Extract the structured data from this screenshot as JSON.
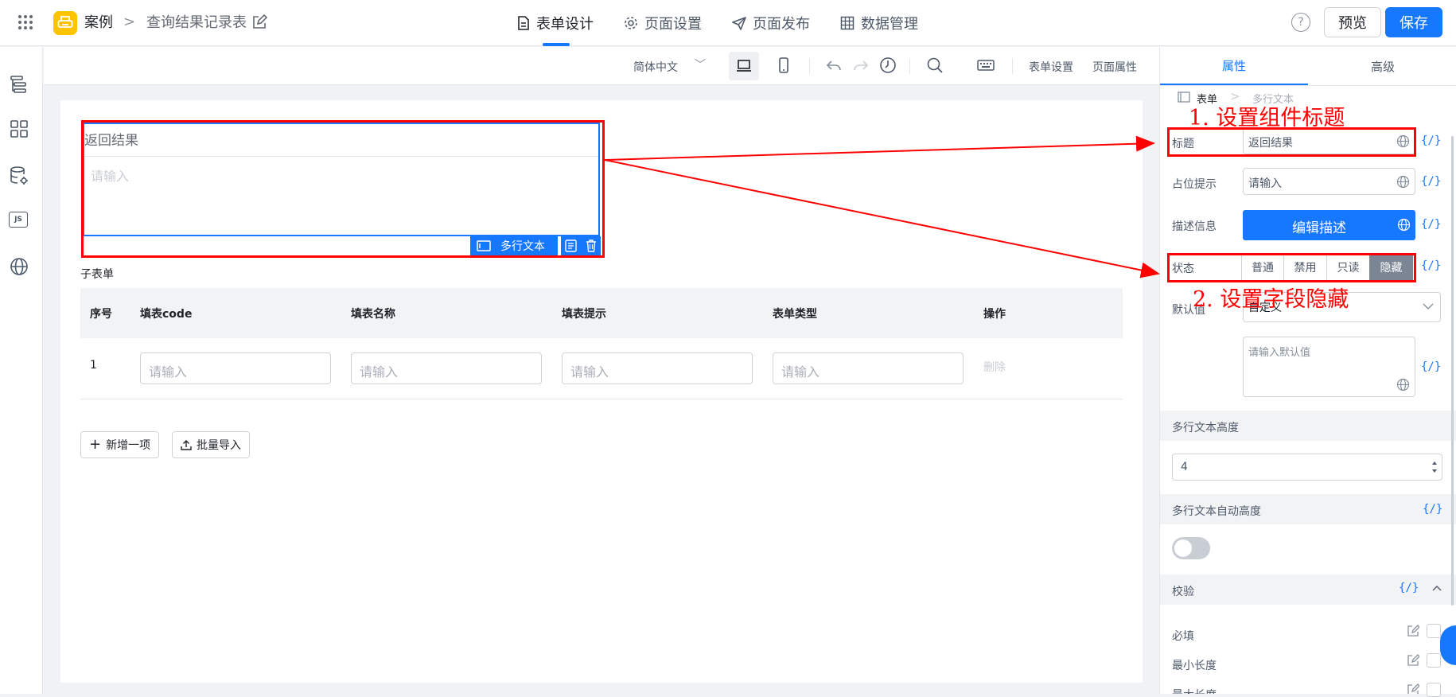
{
  "header": {
    "app_name": "案例",
    "breadcrumb_separator": ">",
    "page_name": "查询结果记录表",
    "tabs": [
      {
        "label": "表单设计",
        "icon": "document-icon",
        "active": true
      },
      {
        "label": "页面设置",
        "icon": "gear-icon",
        "active": false
      },
      {
        "label": "页面发布",
        "icon": "send-icon",
        "active": false
      },
      {
        "label": "数据管理",
        "icon": "table-icon",
        "active": false
      }
    ],
    "help_symbol": "?",
    "preview_label": "预览",
    "save_label": "保存",
    "accent_color": "#1677ff"
  },
  "left_sidebar": {
    "icons": [
      "outline-tree-icon",
      "components-grid-icon",
      "data-source-icon",
      "js-icon",
      "globe-icon"
    ],
    "js_text": "JS"
  },
  "toolbar": {
    "language": "简体中文",
    "language_chevron": "﹀",
    "form_settings": "表单设置",
    "page_properties": "页面属性"
  },
  "canvas": {
    "field": {
      "title": "返回结果",
      "placeholder": "请输入",
      "component_type": "多行文本"
    },
    "subform": {
      "title": "子表单",
      "columns": [
        "序号",
        "填表code",
        "填表名称",
        "填表提示",
        "表单类型",
        "操作"
      ],
      "row": {
        "index": "1",
        "placeholders": [
          "请输入",
          "请输入",
          "请输入",
          "请输入"
        ],
        "action": "删除"
      },
      "add_button": "新增一项",
      "add_icon": "+",
      "import_button": "批量导入"
    }
  },
  "right_panel": {
    "tabs": [
      "属性",
      "高级"
    ],
    "breadcrumb": [
      "表单",
      "多行文本"
    ],
    "title_label": "标题",
    "title_value": "返回结果",
    "placeholder_label": "占位提示",
    "placeholder_value": "请输入",
    "description_label": "描述信息",
    "description_button": "编辑描述",
    "state_label": "状态",
    "state_options": [
      "普通",
      "禁用",
      "只读",
      "隐藏"
    ],
    "state_selected": "隐藏",
    "default_label": "默认值",
    "default_select": "自定义",
    "default_placeholder": "请输入默认值",
    "height_section": "多行文本高度",
    "height_value": "4",
    "auto_height_section": "多行文本自动高度",
    "auto_height_enabled": false,
    "validation_section": "校验",
    "validation_items": [
      "必填",
      "最小长度",
      "最大长度"
    ],
    "code_symbol": "{/}"
  },
  "annotations": {
    "step1": "1. 设置组件标题",
    "step2": "2. 设置字段隐藏",
    "color": "#ff0000"
  }
}
